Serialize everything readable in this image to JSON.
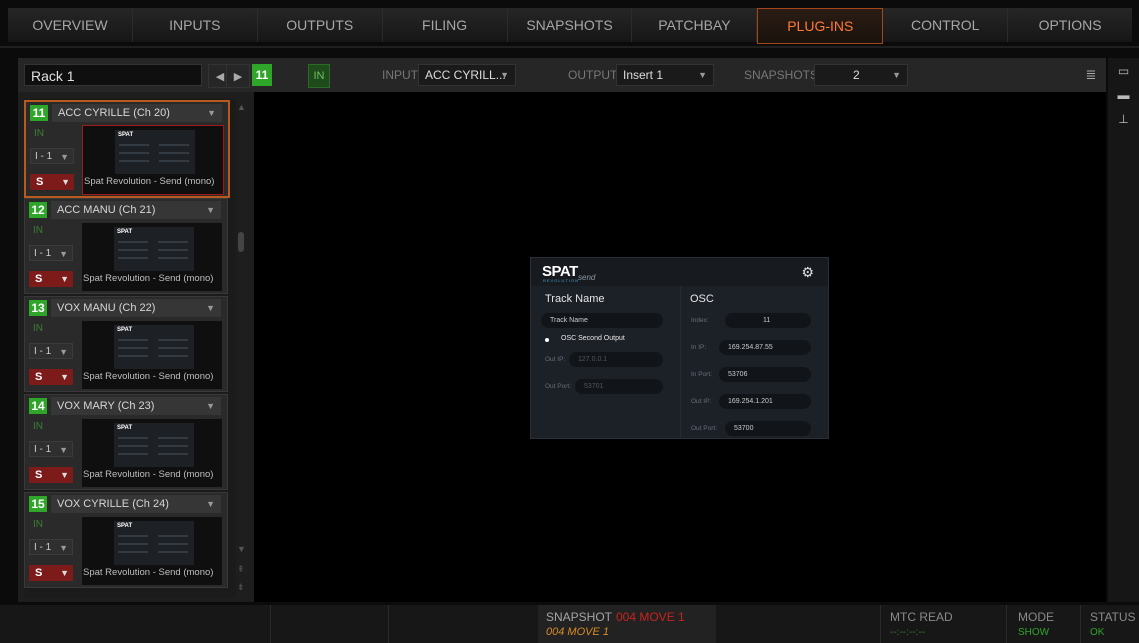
{
  "nav": {
    "tabs": [
      "OVERVIEW",
      "INPUTS",
      "OUTPUTS",
      "FILING",
      "SNAPSHOTS",
      "PATCHBAY",
      "PLUG-INS",
      "CONTROL",
      "OPTIONS"
    ],
    "active": "PLUG-INS"
  },
  "toolbar": {
    "rack_name": "Rack 1",
    "slot_num": "11",
    "in_label": "IN",
    "input_label": "INPUT",
    "input_value": "ACC CYRILL...",
    "output_label": "OUTPUT",
    "output_value": "Insert 1",
    "snapshots_label": "SNAPSHOTS",
    "snapshots_value": "2"
  },
  "slots": [
    {
      "num": "11",
      "name": "ACC CYRILLE (Ch 20)",
      "in": "IN",
      "io": "I - 1",
      "s": "S",
      "plugin": "Spat Revolution - Send (mono)"
    },
    {
      "num": "12",
      "name": "ACC MANU (Ch 21)",
      "in": "IN",
      "io": "I - 1",
      "s": "S",
      "plugin": "Spat Revolution - Send (mono)"
    },
    {
      "num": "13",
      "name": "VOX MANU (Ch 22)",
      "in": "IN",
      "io": "I - 1",
      "s": "S",
      "plugin": "Spat Revolution - Send (mono)"
    },
    {
      "num": "14",
      "name": "VOX MARY (Ch 23)",
      "in": "IN",
      "io": "I - 1",
      "s": "S",
      "plugin": "Spat Revolution - Send (mono)"
    },
    {
      "num": "15",
      "name": "VOX CYRILLE (Ch 24)",
      "in": "IN",
      "io": "I - 1",
      "s": "S",
      "plugin": "Spat Revolution - Send (mono)"
    }
  ],
  "thumb_logo": "SPAT",
  "plugin": {
    "logo": "SPAT",
    "logo_sub": "REVOLUTION",
    "send_label": "send",
    "track_name_heading": "Track Name",
    "track_name_value": "Track Name",
    "osc_second_output": "OSC Second Output",
    "left_out_ip_label": "Out IP:",
    "left_out_ip_value": "127.0.0.1",
    "left_out_port_label": "Out Port:",
    "left_out_port_value": "53701",
    "osc_heading": "OSC",
    "index_label": "Index:",
    "index_value": "11",
    "in_ip_label": "In IP:",
    "in_ip_value": "169.254.87.55",
    "in_port_label": "In Port:",
    "in_port_value": "53706",
    "out_ip_label": "Out IP:",
    "out_ip_value": "169.254.1.201",
    "out_port_label": "Out Port:",
    "out_port_value": "53700"
  },
  "status": {
    "snapshot_label": "SNAPSHOT",
    "snapshot_value": "004 MOVE 1",
    "snapshot_sub": "004 MOVE 1",
    "mtc_label": "MTC READ",
    "mtc_value": "--:--:--:--",
    "mode_label": "MODE",
    "mode_value": "SHOW",
    "status_label": "STATUS",
    "status_value": "OK"
  }
}
